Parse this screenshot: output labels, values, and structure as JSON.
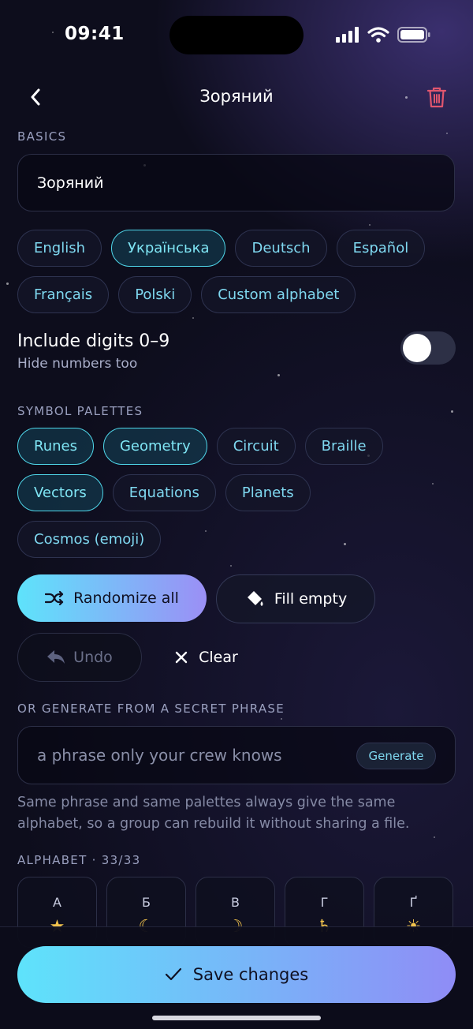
{
  "status_bar": {
    "time": "09:41"
  },
  "nav": {
    "title": "Зоряний"
  },
  "basics": {
    "label": "BASICS",
    "name_value": "Зоряний",
    "languages": [
      {
        "label": "English",
        "active": false
      },
      {
        "label": "Українська",
        "active": true
      },
      {
        "label": "Deutsch",
        "active": false
      },
      {
        "label": "Español",
        "active": false
      },
      {
        "label": "Français",
        "active": false
      },
      {
        "label": "Polski",
        "active": false
      },
      {
        "label": "Custom alphabet",
        "active": false
      }
    ]
  },
  "digits": {
    "title": "Include digits 0–9",
    "subtitle": "Hide numbers too",
    "enabled": false
  },
  "palettes": {
    "label": "SYMBOL PALETTES",
    "items": [
      {
        "label": "Runes",
        "active": true
      },
      {
        "label": "Geometry",
        "active": true
      },
      {
        "label": "Circuit",
        "active": false
      },
      {
        "label": "Braille",
        "active": false
      },
      {
        "label": "Vectors",
        "active": true
      },
      {
        "label": "Equations",
        "active": false
      },
      {
        "label": "Planets",
        "active": false
      },
      {
        "label": "Cosmos (emoji)",
        "active": false
      }
    ]
  },
  "actions": {
    "randomize": "Randomize all",
    "fill_empty": "Fill empty",
    "undo": "Undo",
    "clear": "Clear"
  },
  "secret": {
    "label": "OR GENERATE FROM A SECRET PHRASE",
    "placeholder": "a phrase only your crew knows",
    "generate": "Generate",
    "help": "Same phrase and same palettes always give the same alphabet, so a group can rebuild it without sharing a file."
  },
  "alphabet": {
    "label": "ALPHABET · 33/33",
    "letters": [
      {
        "char": "А",
        "symbol": "★"
      },
      {
        "char": "Б",
        "symbol": "☾"
      },
      {
        "char": "В",
        "symbol": "☽"
      },
      {
        "char": "Г",
        "symbol": "♄"
      },
      {
        "char": "Ґ",
        "symbol": "☀"
      }
    ]
  },
  "save": {
    "label": "Save changes"
  },
  "colors": {
    "accent_cyan": "#5ee3fb",
    "accent_violet": "#9b8ff5",
    "danger": "#e0566e"
  }
}
